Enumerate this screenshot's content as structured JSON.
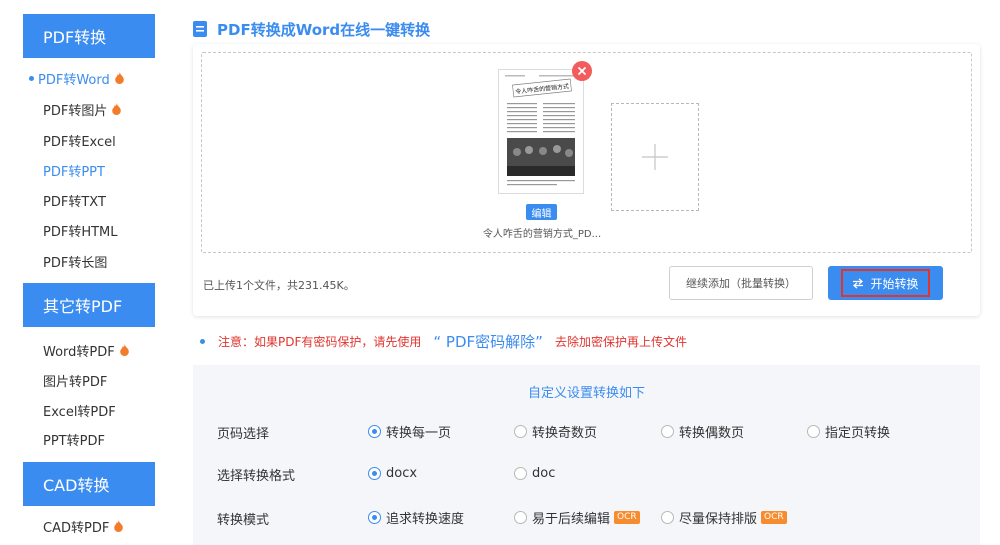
{
  "sidebar": {
    "sections": [
      {
        "heading": "PDF转换",
        "items": [
          {
            "label": "PDF转Word",
            "hot": true,
            "active": true
          },
          {
            "label": "PDF转图片",
            "hot": true
          },
          {
            "label": "PDF转Excel"
          },
          {
            "label": "PDF转PPT",
            "highlight": true
          },
          {
            "label": "PDF转TXT"
          },
          {
            "label": "PDF转HTML"
          },
          {
            "label": "PDF转长图"
          }
        ]
      },
      {
        "heading": "其它转PDF",
        "items": [
          {
            "label": "Word转PDF",
            "hot": true
          },
          {
            "label": "图片转PDF"
          },
          {
            "label": "Excel转PDF"
          },
          {
            "label": "PPT转PDF"
          }
        ]
      },
      {
        "heading": "CAD转换",
        "items": [
          {
            "label": "CAD转PDF",
            "hot": true
          }
        ]
      }
    ]
  },
  "page": {
    "title": "PDF转换成Word在线一键转换"
  },
  "upload": {
    "file": {
      "name": "令人咋舌的营销方式_PD...",
      "edit_label": "编辑",
      "thumb_headline": "令人咋舌的营销方式"
    },
    "info": "已上传1个文件，共231.45K。",
    "add_more_label": "继续添加（批量转换）",
    "start_label": "开始转换"
  },
  "notice": {
    "prefix": "注意：如果PDF有密码保护，请先使用",
    "link": "“ PDF密码解除”",
    "suffix": "去除加密保护再上传文件"
  },
  "settings": {
    "title": "自定义设置转换如下",
    "rows": [
      {
        "label": "页码选择",
        "options": [
          {
            "label": "转换每一页",
            "checked": true
          },
          {
            "label": "转换奇数页"
          },
          {
            "label": "转换偶数页"
          },
          {
            "label": "指定页转换"
          }
        ]
      },
      {
        "label": "选择转换格式",
        "options": [
          {
            "label": "docx",
            "checked": true
          },
          {
            "label": "doc"
          }
        ]
      },
      {
        "label": "转换模式",
        "options": [
          {
            "label": "追求转换速度",
            "checked": true
          },
          {
            "label": "易于后续编辑",
            "badge": "OCR"
          },
          {
            "label": "尽量保持排版",
            "badge": "OCR"
          }
        ]
      }
    ]
  },
  "colors": {
    "accent": "#3b8cf0",
    "warning": "#e0342f",
    "badge": "#f78c2e",
    "panel": "#f4f6f9"
  }
}
